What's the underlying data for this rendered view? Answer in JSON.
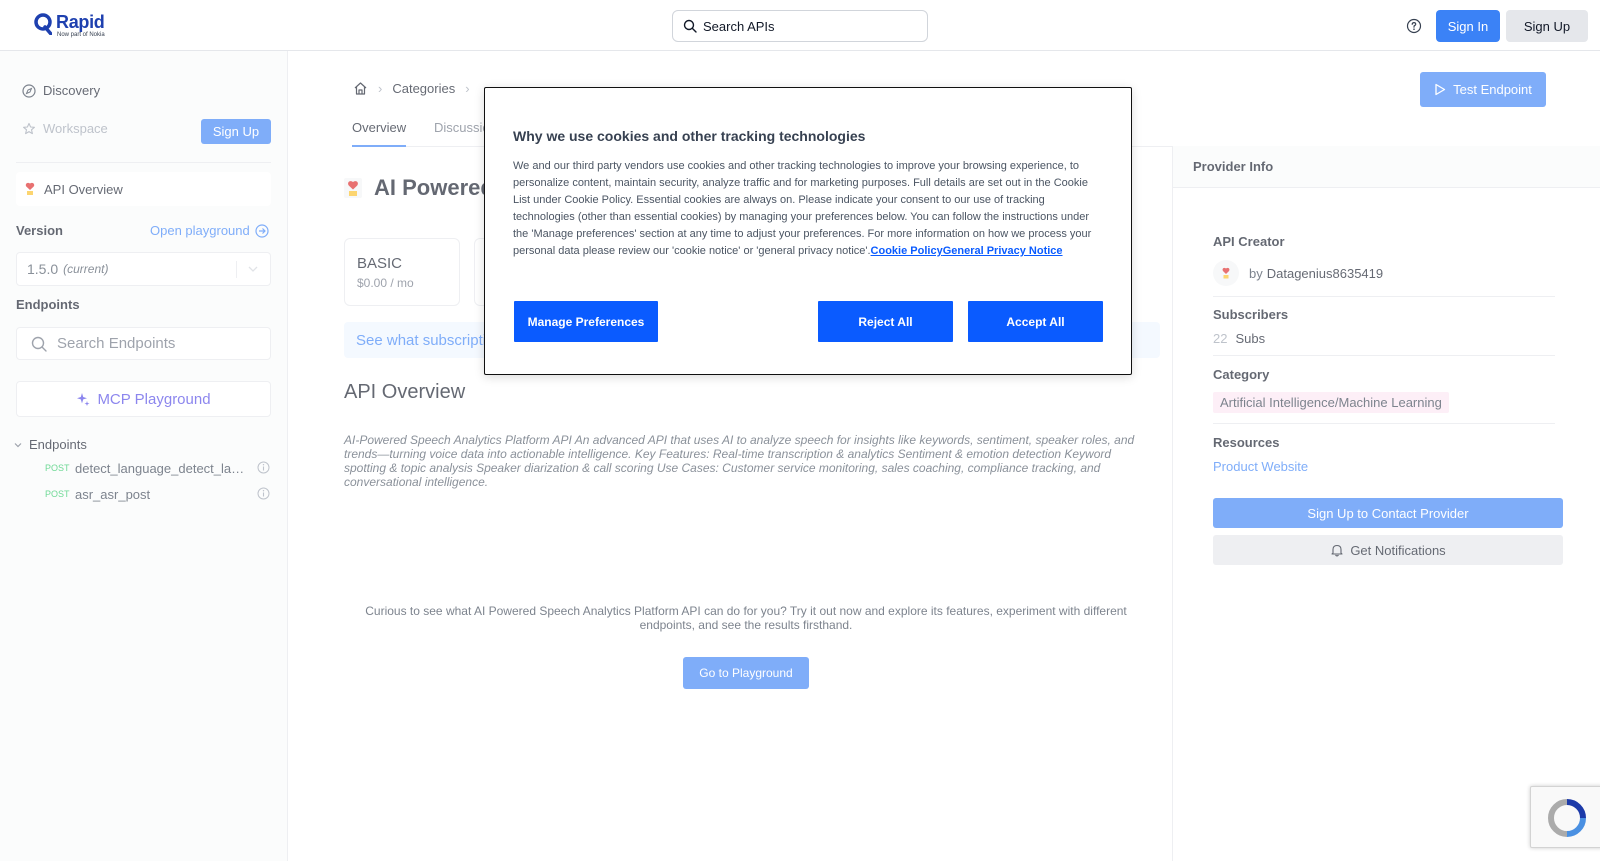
{
  "header": {
    "logo_name": "Rapid",
    "logo_sub": "Now part of Nokia",
    "search_placeholder": "Search APIs",
    "signin_label": "Sign In",
    "signup_label": "Sign Up"
  },
  "sidebar": {
    "discovery_label": "Discovery",
    "workspace_label": "Workspace",
    "signup_label": "Sign Up",
    "api_overview_label": "API Overview",
    "version_label": "Version",
    "open_playground_label": "Open playground",
    "version_value": "1.5.0",
    "version_note": "(current)",
    "endpoints_label": "Endpoints",
    "search_endpoints_placeholder": "Search Endpoints",
    "mcp_label": "MCP Playground",
    "endpoints_group_label": "Endpoints",
    "endpoints": [
      {
        "method": "POST",
        "name": "detect_language_detect_language_post"
      },
      {
        "method": "POST",
        "name": "asr_asr_post"
      }
    ]
  },
  "main": {
    "breadcrumb_categories": "Categories",
    "tabs": [
      {
        "label": "Overview"
      },
      {
        "label": "Discussions"
      }
    ],
    "test_endpoint_label": "Test Endpoint",
    "api_title": "AI Powered Speech Analytics Platform API",
    "plans": [
      {
        "name": "BASIC",
        "price": "$0.00 / mo"
      }
    ],
    "subs_banner": "See what subscription plans are available",
    "section_title": "API Overview",
    "description": "AI-Powered Speech Analytics Platform API An advanced API that uses AI to analyze speech for insights like keywords, sentiment, speaker roles, and trends—turning voice data into actionable intelligence. Key Features: Real-time transcription & analytics Sentiment & emotion detection Keyword spotting & topic analysis Speaker diarization & call scoring Use Cases: Customer service monitoring, sales coaching, compliance tracking, and conversational intelligence.",
    "curious_text": "Curious to see what AI Powered Speech Analytics Platform API can do for you? Try it out now and explore its features, experiment with different endpoints, and see the results firsthand.",
    "go_playground_label": "Go to Playground"
  },
  "provider": {
    "title": "Provider Info",
    "creator_label": "API Creator",
    "by_label": "by",
    "creator_name": "Datagenius8635419",
    "subscribers_label": "Subscribers",
    "subscribers_count": "22",
    "subscribers_unit": "Subs",
    "category_label": "Category",
    "category_value": "Artificial Intelligence/Machine Learning",
    "resources_label": "Resources",
    "product_website_label": "Product Website",
    "contact_label": "Sign Up to Contact Provider",
    "notifications_label": "Get Notifications"
  },
  "cookie_modal": {
    "title": "Why we use cookies and other tracking technologies",
    "body": "We and our third party vendors use cookies and other tracking technologies to improve your browsing experience, to personalize content, maintain security, analyze traffic and for marketing purposes. Full details are set out in the Cookie List under Cookie Policy. Essential cookies are always on. Please indicate your consent to our use of tracking technologies (other than essential cookies) by managing your preferences below. You can follow the instructions under the 'Manage preferences' section at any time to adjust your preferences. For more information on how we process your personal data please review our 'cookie notice' or 'general privacy notice'.",
    "cookie_policy_link": "Cookie Policy",
    "privacy_link": "General Privacy Notice",
    "manage_label": "Manage Preferences",
    "reject_label": "Reject All",
    "accept_label": "Accept All"
  },
  "colors": {
    "primary": "#3b82f6",
    "cookie_button": "#0a5bff",
    "category_badge": "#fce7f3",
    "post_method": "#22c55e"
  }
}
